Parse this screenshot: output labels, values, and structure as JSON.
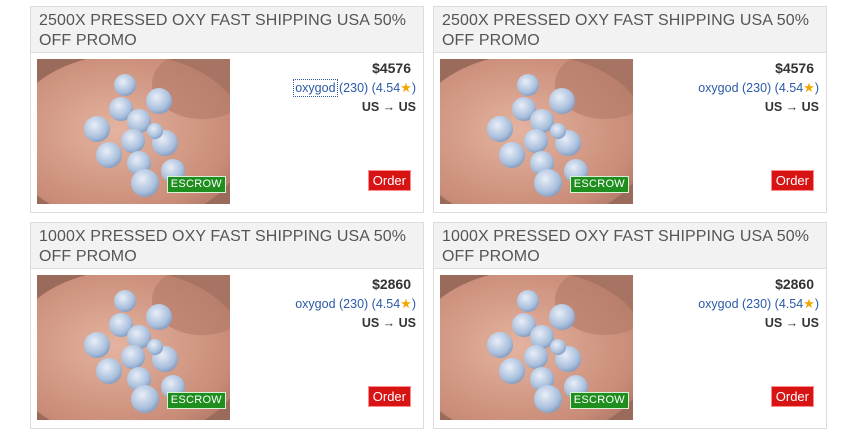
{
  "listings": [
    {
      "title": "2500X PRESSED OXY FAST SHIPPING USA 50% OFF PROMO",
      "price": "$4576",
      "vendor": "oxygod",
      "vendor_stats": " (230) (4.54",
      "stats_close": ")",
      "route": "US → US",
      "escrow": "ESCROW",
      "order": "Order"
    },
    {
      "title": "2500X PRESSED OXY FAST SHIPPING USA 50% OFF PROMO",
      "price": "$4576",
      "vendor": "oxygod",
      "vendor_stats": " (230) (4.54",
      "stats_close": ")",
      "route": "US → US",
      "escrow": "ESCROW",
      "order": "Order"
    },
    {
      "title": "1000X PRESSED OXY FAST SHIPPING USA 50% OFF PROMO",
      "price": "$2860",
      "vendor": "oxygod",
      "vendor_stats": " (230) (4.54",
      "stats_close": ")",
      "route": "US → US",
      "escrow": "ESCROW",
      "order": "Order"
    },
    {
      "title": "1000X PRESSED OXY FAST SHIPPING USA 50% OFF PROMO",
      "price": "$2860",
      "vendor": "oxygod",
      "vendor_stats": " (230) (4.54",
      "stats_close": ")",
      "route": "US → US",
      "escrow": "ESCROW",
      "order": "Order"
    }
  ],
  "icons": {
    "rating": "star-icon",
    "image": "product-photo"
  },
  "colors": {
    "escrow_badge": "#1e8f1e",
    "order_button": "#d81313",
    "vendor_link": "#2a5aa8",
    "star": "#f0a800"
  }
}
